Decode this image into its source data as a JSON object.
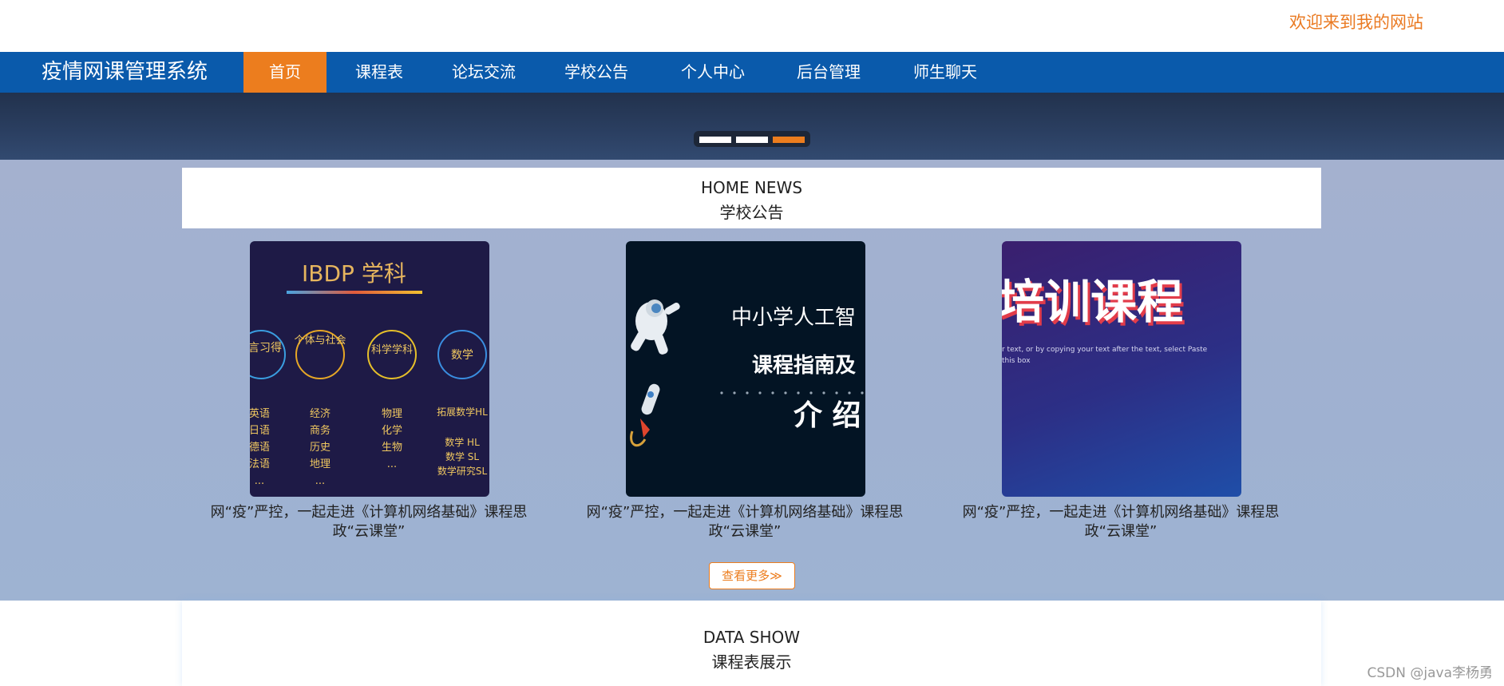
{
  "header": {
    "welcome": "欢迎来到我的网站"
  },
  "nav": {
    "brand": "疫情网课管理系统",
    "items": [
      "首页",
      "课程表",
      "论坛交流",
      "学校公告",
      "个人中心",
      "后台管理",
      "师生聊天"
    ],
    "active_index": 0
  },
  "carousel": {
    "slide_count": 3,
    "active_slide": 3
  },
  "news": {
    "title_en": "HOME NEWS",
    "title_zh": "学校公告",
    "cards": [
      {
        "caption": "网“疫”严控，一起走进《计算机网络基础》课程思政“云课堂”",
        "image": {
          "title": "IBDP 学科",
          "groups": [
            {
              "head": "语言习得",
              "items": [
                "英语",
                "日语",
                "德语",
                "法语",
                "..."
              ]
            },
            {
              "head": "个体与社会",
              "items": [
                "经济",
                "商务",
                "历史",
                "地理",
                "..."
              ]
            },
            {
              "head": "科学学科",
              "items": [
                "物理",
                "化学",
                "生物",
                "..."
              ]
            },
            {
              "head": "数学",
              "items": [
                "拓展数学HL",
                "数学 HL",
                "数学 SL",
                "数学研究SL"
              ]
            }
          ]
        }
      },
      {
        "caption": "网“疫”严控，一起走进《计算机网络基础》课程思政“云课堂”",
        "image": {
          "line1": "中小学人工智",
          "line2": "课程指南及",
          "line3": "介 绍"
        }
      },
      {
        "caption": "网“疫”严控，一起走进《计算机网络基础》课程思政“云课堂”",
        "image": {
          "title": "培训课程",
          "sub1": "r text, or by copying your text after the text, select Paste",
          "sub2": "this box"
        }
      }
    ],
    "more_button": "查看更多≫"
  },
  "data_show": {
    "title_en": "DATA SHOW",
    "title_zh": "课程表展示"
  },
  "watermark": "CSDN @java李杨勇",
  "colors": {
    "nav_bg": "#0a5aab",
    "accent": "#ec7d1e"
  }
}
